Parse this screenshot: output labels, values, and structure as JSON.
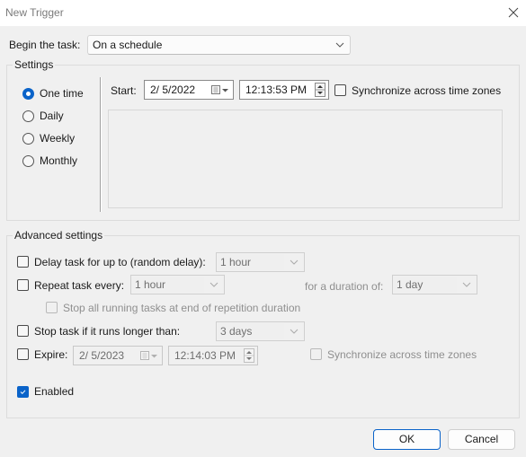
{
  "window": {
    "title": "New Trigger",
    "close_icon": "close-icon"
  },
  "begin": {
    "label": "Begin the task:",
    "value": "On a schedule"
  },
  "settings": {
    "legend": "Settings",
    "schedule_options": [
      {
        "label": "One time",
        "selected": true
      },
      {
        "label": "Daily",
        "selected": false
      },
      {
        "label": "Weekly",
        "selected": false
      },
      {
        "label": "Monthly",
        "selected": false
      }
    ],
    "start_label": "Start:",
    "start_date": "2/  5/2022",
    "start_time": "12:13:53 PM",
    "sync_label": "Synchronize across time zones",
    "sync_checked": false
  },
  "advanced": {
    "legend": "Advanced settings",
    "delay": {
      "label": "Delay task for up to (random delay):",
      "checked": false,
      "value": "1 hour"
    },
    "repeat": {
      "label": "Repeat task every:",
      "checked": false,
      "value": "1 hour",
      "duration_label": "for a duration of:",
      "duration_value": "1 day",
      "stop_all_label": "Stop all running tasks at end of repetition duration",
      "stop_all_checked": false
    },
    "stop_longer": {
      "label": "Stop task if it runs longer than:",
      "checked": false,
      "value": "3 days"
    },
    "expire": {
      "label": "Expire:",
      "checked": false,
      "date": "2/  5/2023",
      "time": "12:14:03 PM",
      "sync_label": "Synchronize across time zones",
      "sync_checked": false
    },
    "enabled": {
      "label": "Enabled",
      "checked": true
    }
  },
  "buttons": {
    "ok": "OK",
    "cancel": "Cancel"
  },
  "colors": {
    "accent": "#0a63c9",
    "background": "#f0f0f0",
    "titlebar": "#ffffff"
  }
}
